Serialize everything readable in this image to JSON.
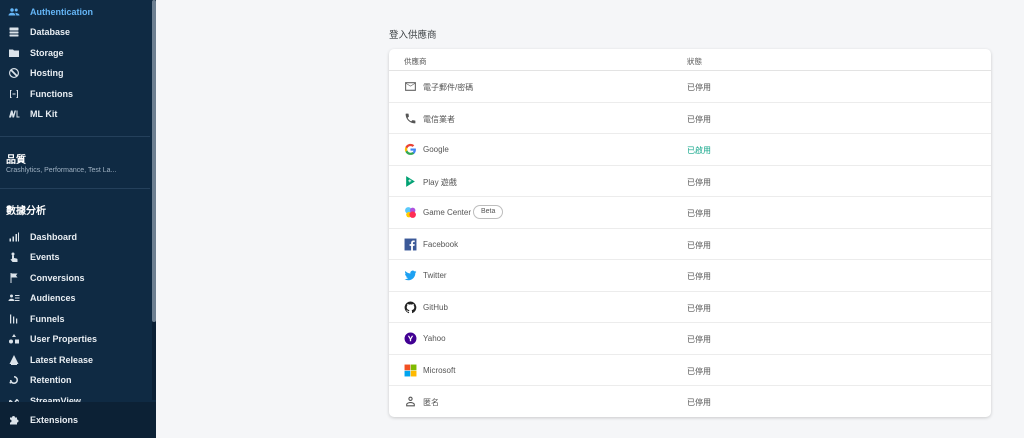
{
  "sidebar": {
    "build_items": [
      {
        "label": "Authentication",
        "icon": "people-icon",
        "active": true
      },
      {
        "label": "Database",
        "icon": "database-icon"
      },
      {
        "label": "Storage",
        "icon": "folder-icon"
      },
      {
        "label": "Hosting",
        "icon": "globe-icon"
      },
      {
        "label": "Functions",
        "icon": "functions-icon"
      },
      {
        "label": "ML Kit",
        "icon": "ml-kit-icon"
      }
    ],
    "quality": {
      "title": "品質",
      "subtitle": "Crashlytics, Performance, Test La..."
    },
    "analytics": {
      "title": "數據分析",
      "items": [
        {
          "label": "Dashboard",
          "icon": "bar-chart-icon"
        },
        {
          "label": "Events",
          "icon": "touch-icon"
        },
        {
          "label": "Conversions",
          "icon": "flag-icon"
        },
        {
          "label": "Audiences",
          "icon": "audience-icon"
        },
        {
          "label": "Funnels",
          "icon": "funnel-icon"
        },
        {
          "label": "User Properties",
          "icon": "user-properties-icon"
        },
        {
          "label": "Latest Release",
          "icon": "release-icon"
        },
        {
          "label": "Retention",
          "icon": "retention-icon"
        },
        {
          "label": "StreamView",
          "icon": "streamview-icon"
        }
      ]
    },
    "extensions": {
      "label": "Extensions",
      "icon": "puzzle-icon"
    }
  },
  "main": {
    "title": "登入供應商",
    "table": {
      "headers": {
        "provider": "供應商",
        "status": "狀態"
      },
      "rows": [
        {
          "name": "電子郵件/密碼",
          "icon": "email-icon",
          "status": "已停用"
        },
        {
          "name": "電信業者",
          "icon": "phone-icon",
          "status": "已停用"
        },
        {
          "name": "Google",
          "icon": "google-icon",
          "status": "已啟用"
        },
        {
          "name": "Play 遊戲",
          "icon": "play-games-icon",
          "status": "已停用"
        },
        {
          "name": "Game Center",
          "icon": "game-center-icon",
          "status": "已停用",
          "badge": "Beta"
        },
        {
          "name": "Facebook",
          "icon": "facebook-icon",
          "status": "已停用"
        },
        {
          "name": "Twitter",
          "icon": "twitter-icon",
          "status": "已停用"
        },
        {
          "name": "GitHub",
          "icon": "github-icon",
          "status": "已停用"
        },
        {
          "name": "Yahoo",
          "icon": "yahoo-icon",
          "status": "已停用"
        },
        {
          "name": "Microsoft",
          "icon": "microsoft-icon",
          "status": "已停用"
        },
        {
          "name": "匿名",
          "icon": "anonymous-icon",
          "status": "已停用"
        }
      ]
    }
  },
  "colors": {
    "sidebar_bg": "#0f2a43",
    "active": "#64b5f6",
    "enabled": "#12a68a",
    "page_bg": "#f5f6f8"
  }
}
